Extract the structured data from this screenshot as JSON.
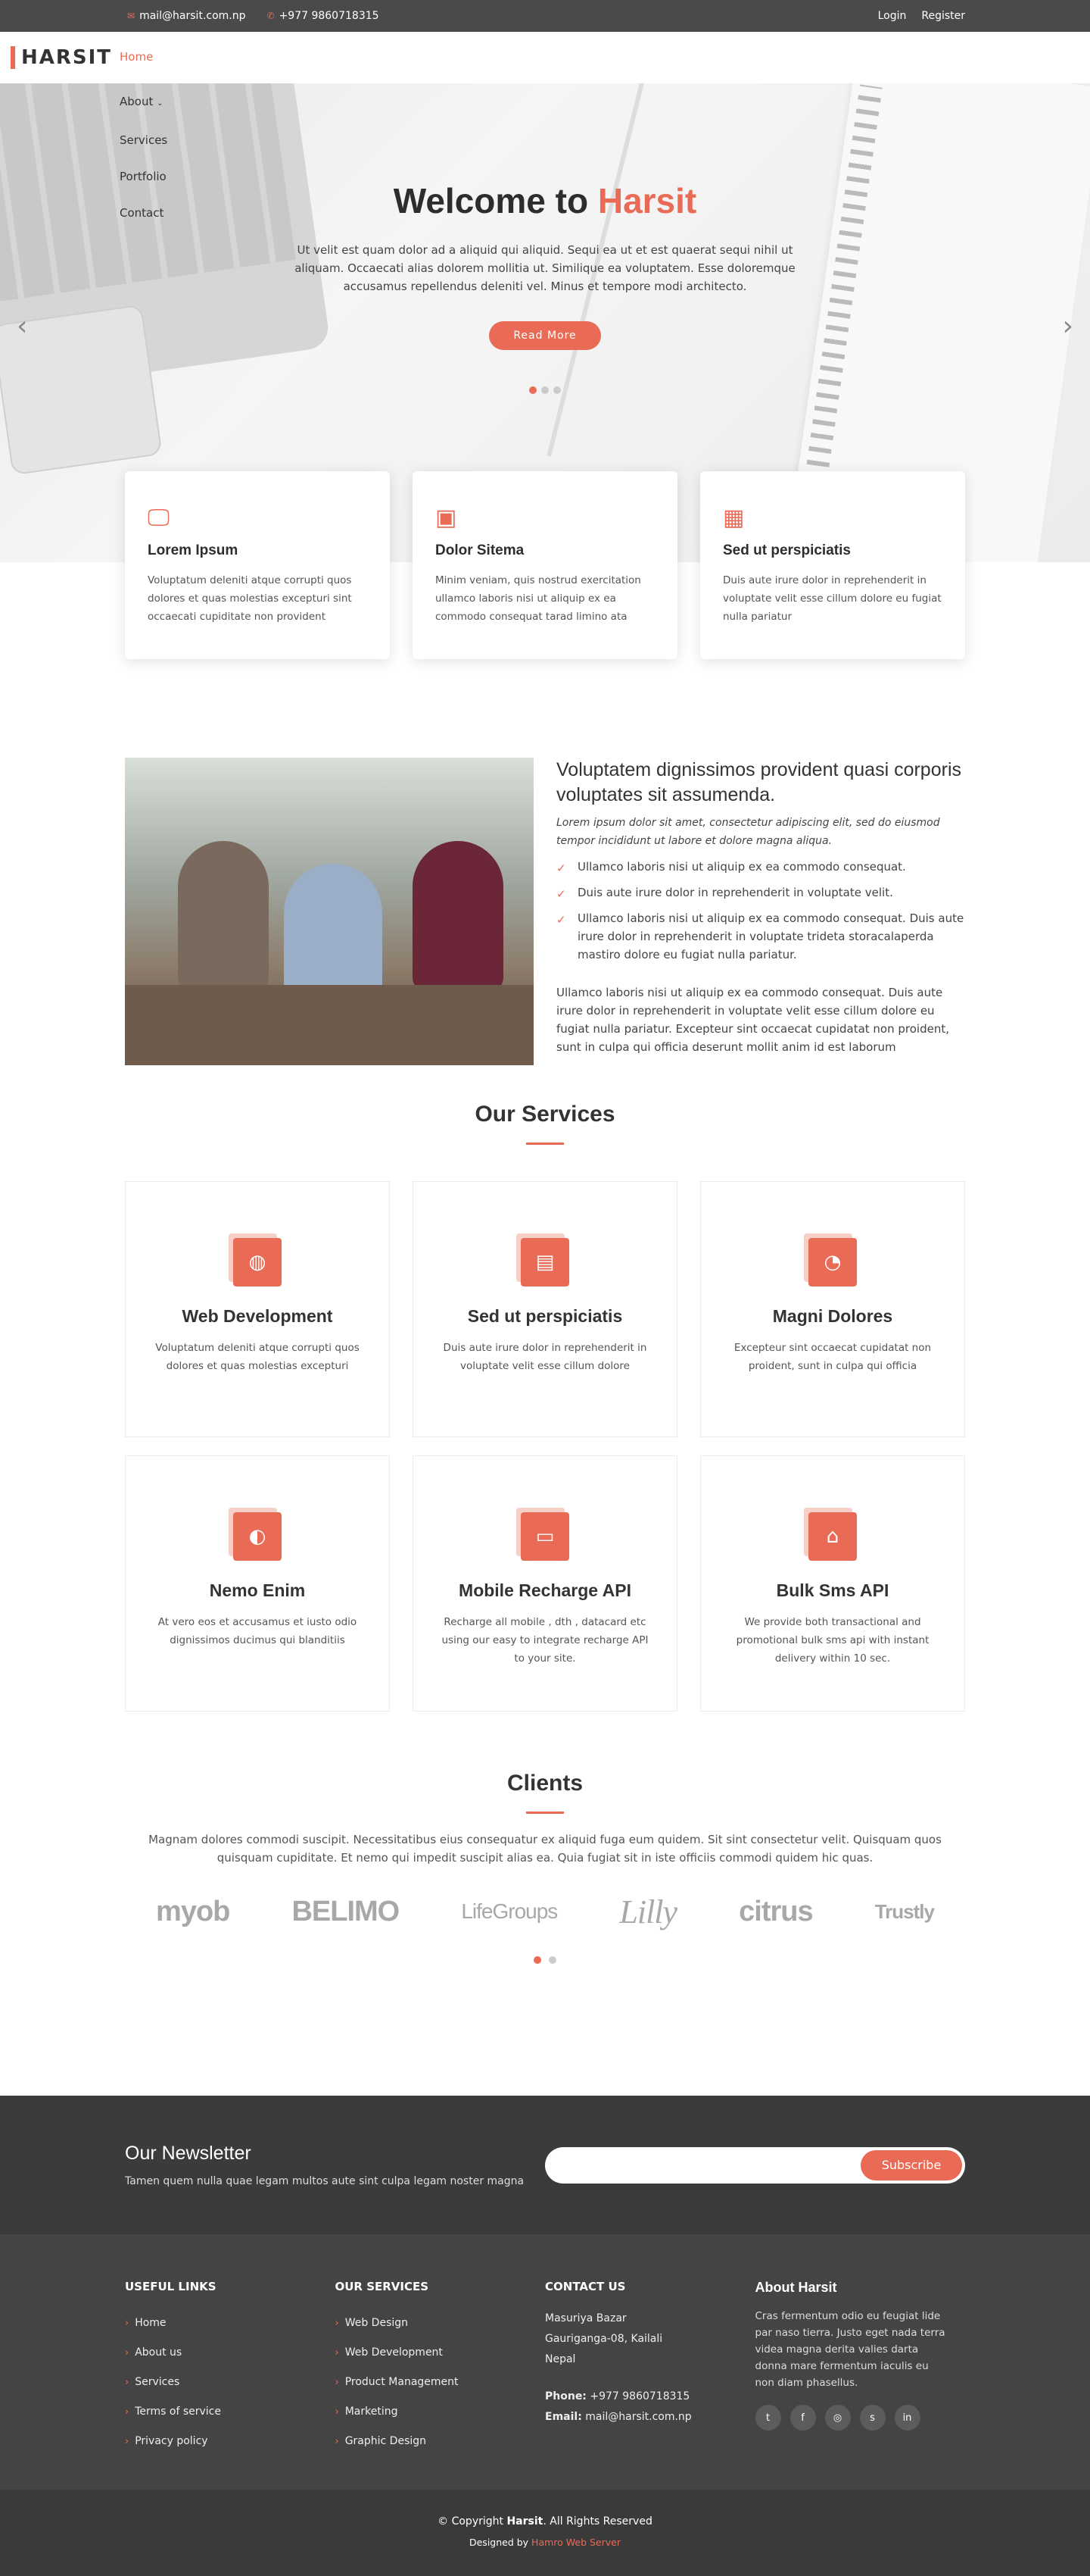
{
  "topbar": {
    "email": "mail@harsit.com.np",
    "phone": "+977 9860718315",
    "login": "Login",
    "register": "Register"
  },
  "header": {
    "logo": "HARSIT",
    "nav": {
      "home": "Home",
      "about": "About",
      "services": "Services",
      "portfolio": "Portfolio",
      "contact": "Contact"
    }
  },
  "hero": {
    "title_main": "Welcome to ",
    "title_accent": "Harsit",
    "text": "Ut velit est quam dolor ad a aliquid qui aliquid. Sequi ea ut et est quaerat sequi nihil ut aliquam. Occaecati alias dolorem mollitia ut. Similique ea voluptatem. Esse doloremque accusamus repellendus deleniti vel. Minus et tempore modi architecto.",
    "button": "Read More"
  },
  "features": [
    {
      "icon": "monitor-icon",
      "title": "Lorem Ipsum",
      "text": "Voluptatum deleniti atque corrupti quos dolores et quas molestias excepturi sint occaecati cupiditate non provident"
    },
    {
      "icon": "image-icon",
      "title": "Dolor Sitema",
      "text": "Minim veniam, quis nostrud exercitation ullamco laboris nisi ut aliquip ex ea commodo consequat tarad limino ata"
    },
    {
      "icon": "calendar-icon",
      "title": "Sed ut perspiciatis",
      "text": "Duis aute irure dolor in reprehenderit in voluptate velit esse cillum dolore eu fugiat nulla pariatur"
    }
  ],
  "about": {
    "title": "Voluptatem dignissimos provident quasi corporis voluptates sit assumenda.",
    "lead": "Lorem ipsum dolor sit amet, consectetur adipiscing elit, sed do eiusmod tempor incididunt ut labore et dolore magna aliqua.",
    "items": [
      "Ullamco laboris nisi ut aliquip ex ea commodo consequat.",
      "Duis aute irure dolor in reprehenderit in voluptate velit.",
      "Ullamco laboris nisi ut aliquip ex ea commodo consequat. Duis aute irure dolor in reprehenderit in voluptate trideta storacalaperda mastiro dolore eu fugiat nulla pariatur."
    ],
    "para": "Ullamco laboris nisi ut aliquip ex ea commodo consequat. Duis aute irure dolor in reprehenderit in voluptate velit esse cillum dolore eu fugiat nulla pariatur. Excepteur sint occaecat cupidatat non proident, sunt in culpa qui officia deserunt mollit anim id est laborum"
  },
  "services": {
    "title": "Our Services",
    "items": [
      {
        "icon": "dribbble-icon",
        "title": "Web Development",
        "text": "Voluptatum deleniti atque corrupti quos dolores et quas molestias excepturi"
      },
      {
        "icon": "document-icon",
        "title": "Sed ut perspiciatis",
        "text": "Duis aute irure dolor in reprehenderit in voluptate velit esse cillum dolore"
      },
      {
        "icon": "speedometer-icon",
        "title": "Magni Dolores",
        "text": "Excepteur sint occaecat cupidatat non proident, sunt in culpa qui officia"
      },
      {
        "icon": "globe-icon",
        "title": "Nemo Enim",
        "text": "At vero eos et accusamus et iusto odio dignissimos ducimus qui blanditiis"
      },
      {
        "icon": "presentation-icon",
        "title": "Mobile Recharge API",
        "text": "Recharge all mobile , dth , datacard etc using our easy to integrate recharge API to your site."
      },
      {
        "icon": "building-icon",
        "title": "Bulk Sms API",
        "text": "We provide both transactional and promotional bulk sms api with instant delivery within 10 sec."
      }
    ]
  },
  "clients": {
    "title": "Clients",
    "text": "Magnam dolores commodi suscipit. Necessitatibus eius consequatur ex aliquid fuga eum quidem. Sit sint consectetur velit. Quisquam quos quisquam cupiditate. Et nemo qui impedit suscipit alias ea. Quia fugiat sit in iste officiis commodi quidem hic quas.",
    "logos": [
      "myob",
      "BELIMO",
      "LifeGroups",
      "Lilly",
      "citrus",
      "Trustly"
    ]
  },
  "newsletter": {
    "title": "Our Newsletter",
    "text": "Tamen quem nulla quae legam multos aute sint culpa legam noster magna",
    "button": "Subscribe"
  },
  "footer": {
    "links_title": "Useful Links",
    "links": [
      "Home",
      "About us",
      "Services",
      "Terms of service",
      "Privacy policy"
    ],
    "services_title": "Our Services",
    "services": [
      "Web Design",
      "Web Development",
      "Product Management",
      "Marketing",
      "Graphic Design"
    ],
    "contact_title": "Contact Us",
    "address1": "Masuriya Bazar",
    "address2": "Gauriganga-08, Kailali",
    "address3": "Nepal",
    "phone_label": "Phone:",
    "phone": "+977 9860718315",
    "email_label": "Email:",
    "email": "mail@harsit.com.np",
    "about_title": "About Harsit",
    "about_text": "Cras fermentum odio eu feugiat lide par naso tierra. Justo eget nada terra videa magna derita valies darta donna mare fermentum iaculis eu non diam phasellus.",
    "social": [
      "twitter-icon",
      "facebook-icon",
      "instagram-icon",
      "skype-icon",
      "linkedin-icon"
    ]
  },
  "bottom": {
    "copyright_pre": "© Copyright ",
    "brand": "Harsit",
    "copyright_post": ". All Rights Reserved",
    "designed_by": "Designed by ",
    "designer": "Hamro Web Server"
  },
  "colors": {
    "accent": "#e96b56",
    "dark": "#3b3b3b",
    "topbar": "#4a4a4a"
  }
}
